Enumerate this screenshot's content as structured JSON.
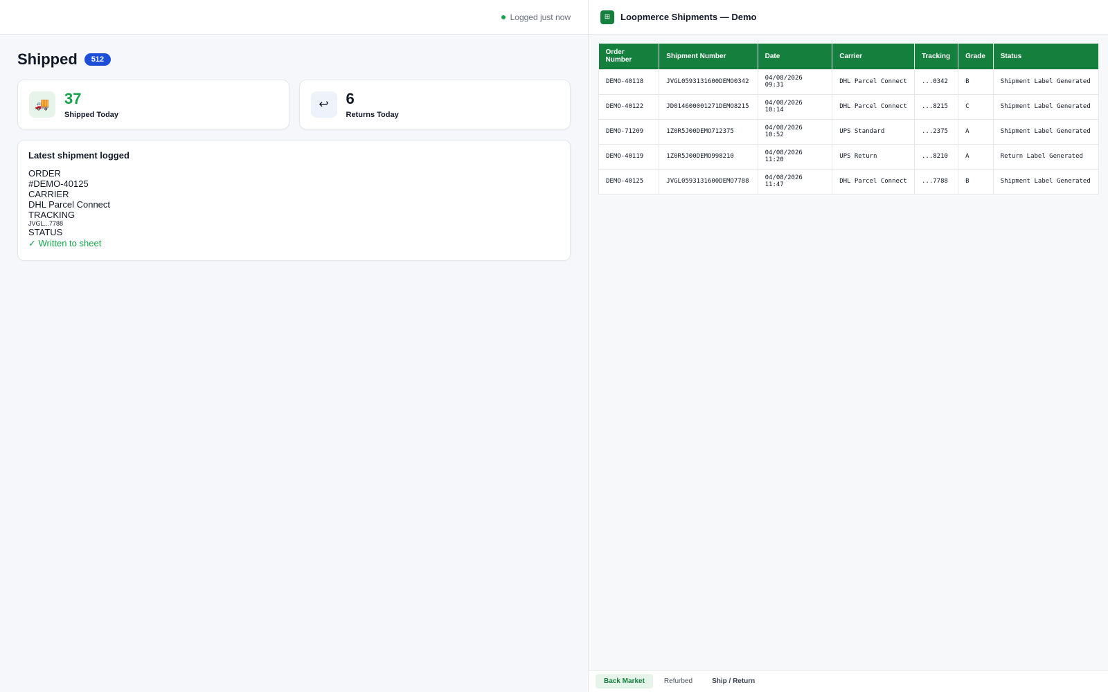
{
  "left": {
    "status_text": "Logged just now",
    "page_title": "Shipped",
    "count_badge": "512",
    "stats": [
      {
        "icon": "truck-icon",
        "value": "37",
        "label": "Shipped Today"
      },
      {
        "icon": "return-arrow-icon",
        "value": "6",
        "label": "Returns Today"
      }
    ],
    "latest": {
      "title": "Latest shipment logged",
      "order_label": "ORDER",
      "order_value": "#DEMO-40125",
      "carrier_label": "CARRIER",
      "carrier_value": "DHL Parcel Connect",
      "tracking_label": "TRACKING",
      "tracking_value": "JVGL...7788",
      "status_label": "STATUS",
      "status_value": "✓ Written to sheet"
    }
  },
  "right": {
    "sheet_title": "Loopmerce Shipments — Demo",
    "columns": [
      "Order Number",
      "Shipment Number",
      "Date",
      "Carrier",
      "Tracking",
      "Grade",
      "Status"
    ],
    "rows": [
      [
        "DEMO-40118",
        "JVGL0593131600DEMO0342",
        "04/08/2026 09:31",
        "DHL Parcel Connect",
        "...0342",
        "B",
        "Shipment Label Generated"
      ],
      [
        "DEMO-40122",
        "JD014600001271DEMO8215",
        "04/08/2026 10:14",
        "DHL Parcel Connect",
        "...8215",
        "C",
        "Shipment Label Generated"
      ],
      [
        "DEMO-71209",
        "1Z0R5J00DEMO712375",
        "04/08/2026 10:52",
        "UPS Standard",
        "...2375",
        "A",
        "Shipment Label Generated"
      ],
      [
        "DEMO-40119",
        "1Z0R5J00DEMO998210",
        "04/08/2026 11:20",
        "UPS Return",
        "...8210",
        "A",
        "Return Label Generated"
      ],
      [
        "DEMO-40125",
        "JVGL0593131600DEMO7788",
        "04/08/2026 11:47",
        "DHL Parcel Connect",
        "...7788",
        "B",
        "Shipment Label Generated"
      ]
    ],
    "tabs": [
      "Back Market",
      "Refurbed",
      "Ship / Return"
    ]
  },
  "colors": {
    "accent_green": "#15803d",
    "success_green": "#16a34a",
    "badge_blue": "#1d4ed8"
  }
}
